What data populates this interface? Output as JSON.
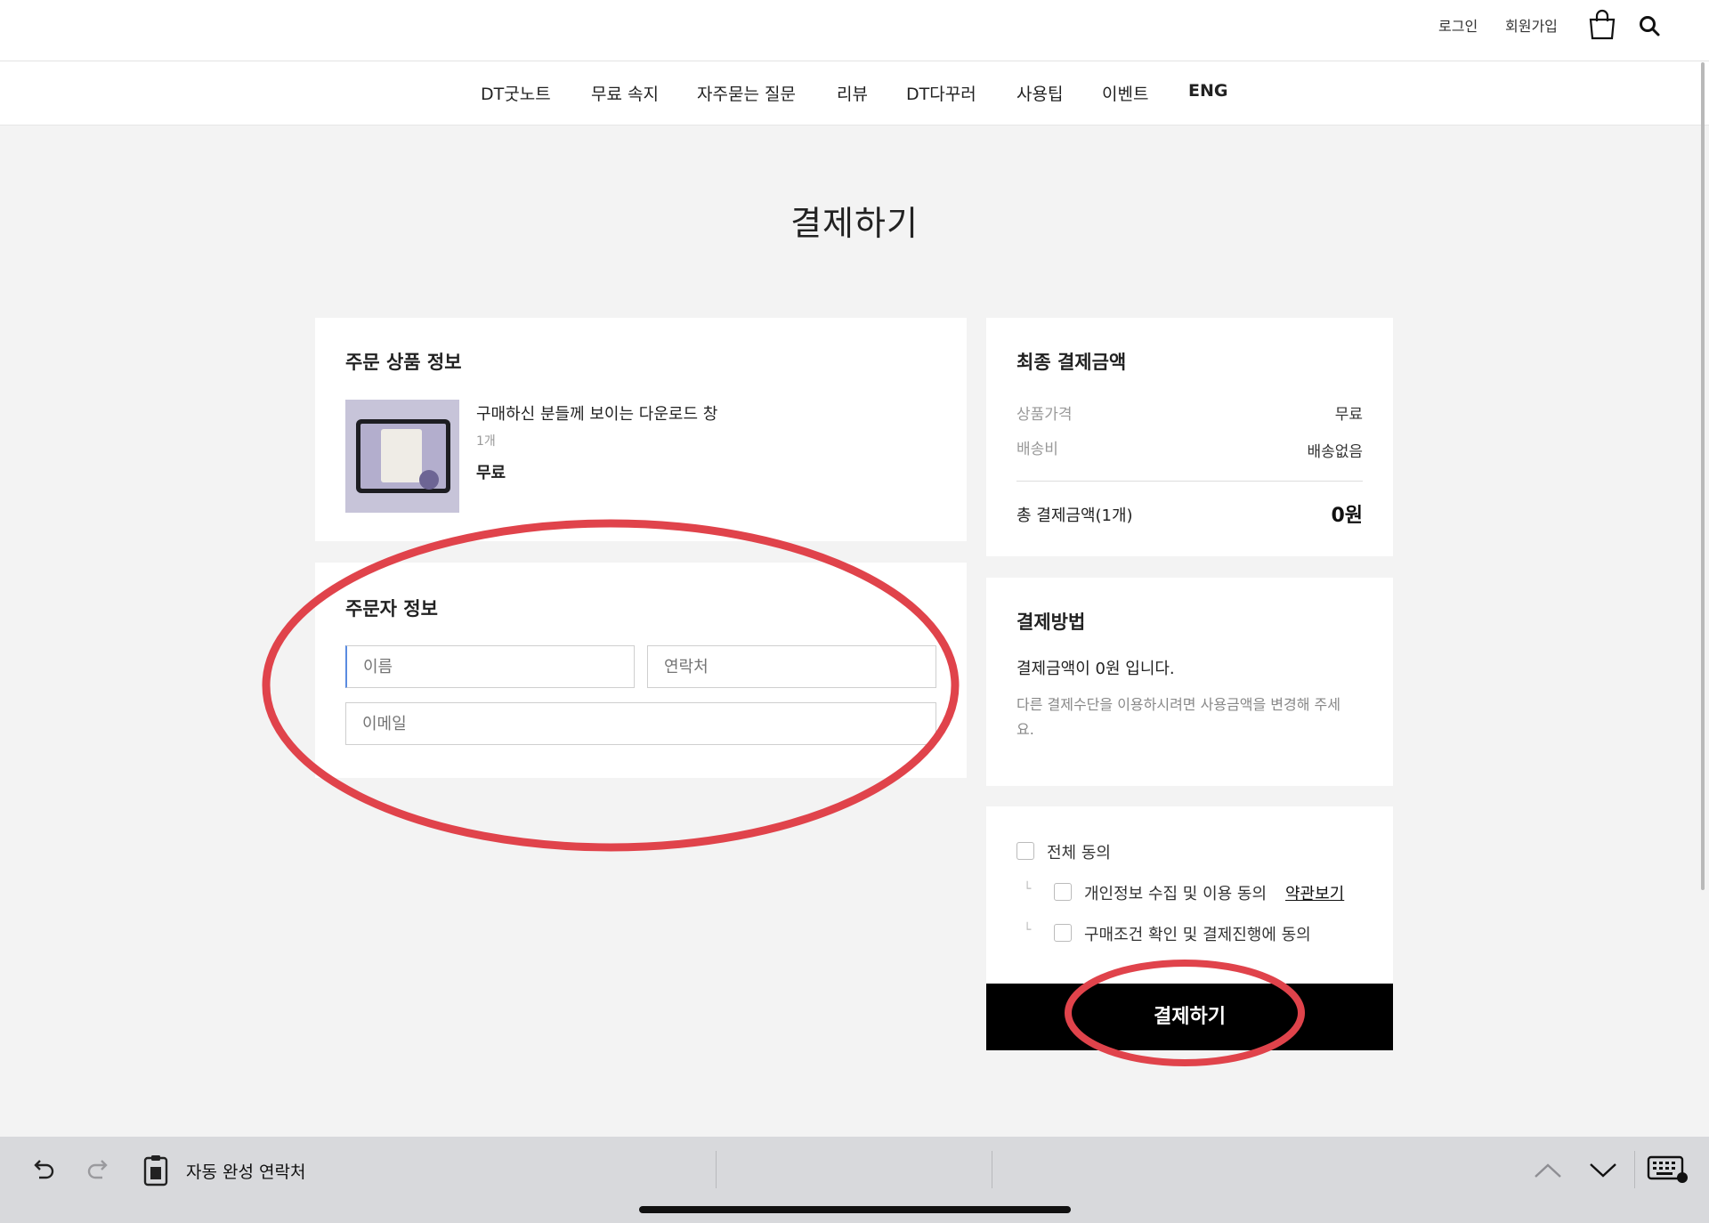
{
  "header": {
    "login": "로그인",
    "signup": "회원가입"
  },
  "nav": {
    "items": [
      "DT굿노트",
      "무료 속지",
      "자주묻는 질문",
      "리뷰",
      "DT다꾸러",
      "사용팁",
      "이벤트",
      "ENG"
    ]
  },
  "page_title": "결제하기",
  "order_product": {
    "title": "주문 상품 정보",
    "product_name": "구매하신 분들께 보이는 다운로드 창",
    "quantity": "1개",
    "price": "무료"
  },
  "orderer": {
    "title": "주문자 정보",
    "name_placeholder": "이름",
    "phone_placeholder": "연락처",
    "email_placeholder": "이메일"
  },
  "summary": {
    "title": "최종 결제금액",
    "product_price_label": "상품가격",
    "product_price_value": "무료",
    "shipping_label": "배송비",
    "shipping_value": "배송없음",
    "total_label": "총 결제금액(1개)",
    "total_value": "0원"
  },
  "payment_method": {
    "title": "결제방법",
    "amount_text": "결제금액이 0원 입니다.",
    "note": "다른 결제수단을 이용하시려면 사용금액을 변경해 주세요."
  },
  "agreements": {
    "all": "전체 동의",
    "privacy": "개인정보 수집 및 이용 동의",
    "view_terms": "약관보기",
    "purchase": "구매조건 확인 및 결제진행에 동의"
  },
  "pay_button": "결제하기",
  "keyboard_bar": {
    "autofill": "자동 완성 연락처"
  },
  "colors": {
    "annotation": "#e0434b",
    "button": "#000000",
    "background": "#f3f3f3"
  },
  "icons": [
    "shopping-bag-icon",
    "search-icon",
    "undo-icon",
    "redo-icon",
    "clipboard-icon",
    "chevron-up-icon",
    "chevron-down-icon",
    "keyboard-icon"
  ]
}
